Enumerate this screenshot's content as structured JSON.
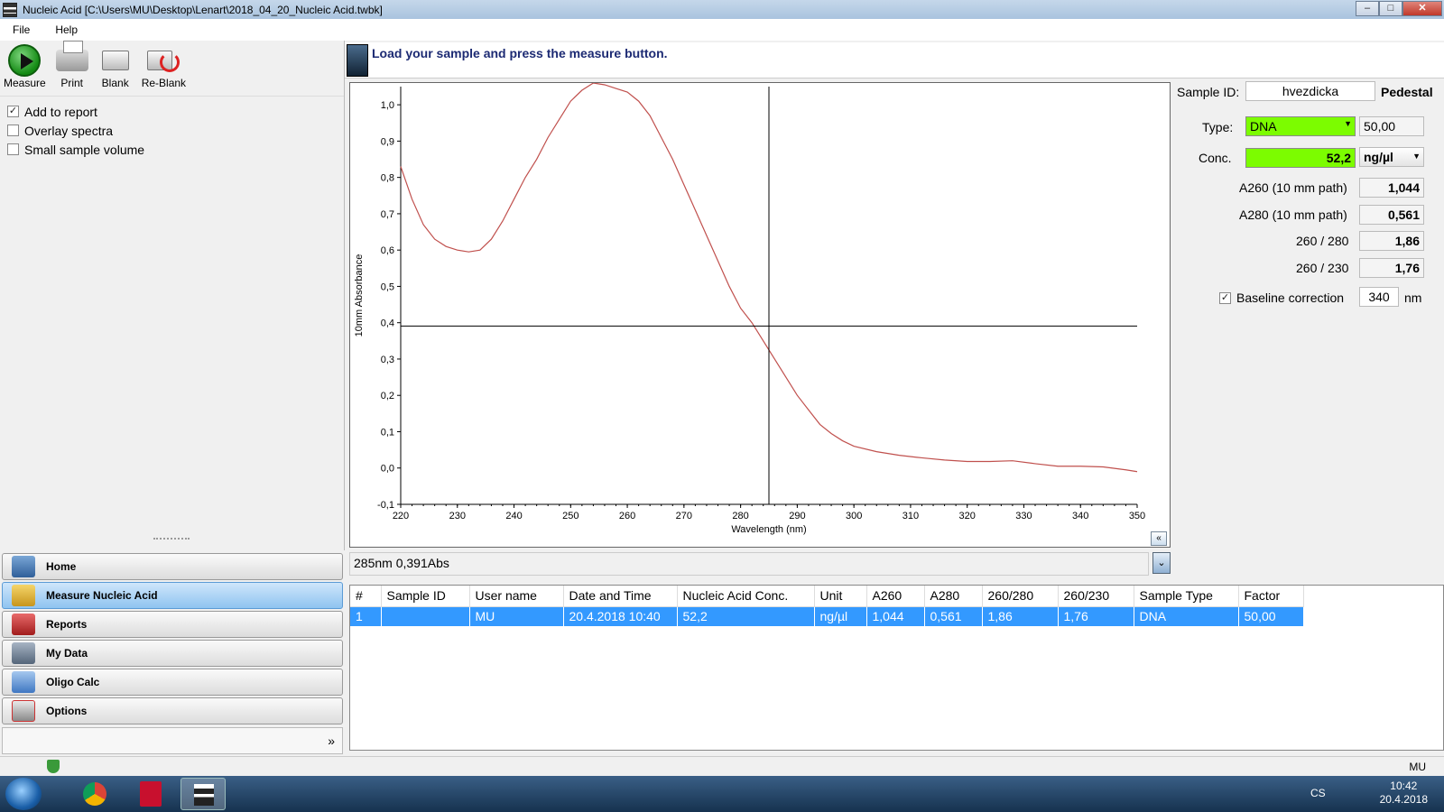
{
  "window": {
    "title": "Nucleic Acid  [C:\\Users\\MU\\Desktop\\Lenart\\2018_04_20_Nucleic Acid.twbk]",
    "minimize": "–",
    "maximize": "□",
    "close": "✕"
  },
  "menu": {
    "file": "File",
    "help": "Help"
  },
  "toolbar": {
    "measure": "Measure",
    "print": "Print",
    "blank": "Blank",
    "reblank": "Re-Blank"
  },
  "options": {
    "add_to_report": {
      "label": "Add to report",
      "checked": true
    },
    "overlay_spectra": {
      "label": "Overlay spectra",
      "checked": false
    },
    "small_sample_volume": {
      "label": "Small sample volume",
      "checked": false
    }
  },
  "nav": {
    "items": [
      {
        "label": "Home",
        "icon": "home-icon"
      },
      {
        "label": "Measure Nucleic Acid",
        "icon": "measure-icon",
        "active": true
      },
      {
        "label": "Reports",
        "icon": "reports-icon"
      },
      {
        "label": "My Data",
        "icon": "my-data-icon"
      },
      {
        "label": "Oligo Calc",
        "icon": "calculator-icon"
      },
      {
        "label": "Options",
        "icon": "options-icon"
      }
    ],
    "expand": "»"
  },
  "instruction": "Load your sample and press the measure button.",
  "chart_data": {
    "type": "line",
    "title": "",
    "xlabel": "Wavelength (nm)",
    "ylabel": "10mm Absorbance",
    "xlim": [
      220,
      350
    ],
    "ylim": [
      -0.1,
      1.05
    ],
    "xticks": [
      "220",
      "230",
      "240",
      "250",
      "260",
      "270",
      "280",
      "290",
      "300",
      "310",
      "320",
      "330",
      "340",
      "350"
    ],
    "yticks": [
      "1,0",
      "0,9",
      "0,8",
      "0,7",
      "0,6",
      "0,5",
      "0,4",
      "0,3",
      "0,2",
      "0,1",
      "0,0",
      "-0,1"
    ],
    "cursor": {
      "x": 285,
      "y": 0.391
    },
    "series": [
      {
        "color": "#c0504d",
        "x": [
          220,
          222,
          224,
          226,
          228,
          230,
          232,
          234,
          236,
          238,
          240,
          242,
          244,
          246,
          248,
          250,
          252,
          254,
          256,
          258,
          260,
          262,
          264,
          266,
          268,
          270,
          272,
          274,
          276,
          278,
          280,
          282,
          284,
          286,
          288,
          290,
          292,
          294,
          296,
          298,
          300,
          304,
          308,
          312,
          316,
          320,
          324,
          328,
          332,
          336,
          340,
          344,
          348,
          350
        ],
        "y": [
          0.83,
          0.74,
          0.67,
          0.63,
          0.61,
          0.6,
          0.595,
          0.6,
          0.63,
          0.68,
          0.74,
          0.8,
          0.85,
          0.91,
          0.96,
          1.01,
          1.04,
          1.06,
          1.055,
          1.045,
          1.035,
          1.01,
          0.97,
          0.91,
          0.85,
          0.78,
          0.71,
          0.64,
          0.57,
          0.5,
          0.44,
          0.4,
          0.35,
          0.3,
          0.25,
          0.2,
          0.16,
          0.12,
          0.095,
          0.075,
          0.06,
          0.045,
          0.035,
          0.028,
          0.022,
          0.018,
          0.018,
          0.02,
          0.012,
          0.005,
          0.005,
          0.003,
          -0.005,
          -0.01
        ]
      }
    ]
  },
  "readout": "285nm 0,391Abs",
  "sample": {
    "id_label": "Sample ID:",
    "id_value": "hvezdicka",
    "mode": "Pedestal",
    "type_label": "Type:",
    "type_value": "DNA",
    "factor": "50,00",
    "conc_label": "Conc.",
    "conc_value": "52,2",
    "unit": "ng/µl",
    "a260_label": "A260 (10 mm path)",
    "a260_value": "1,044",
    "a280_label": "A280 (10 mm path)",
    "a280_value": "0,561",
    "r260_280_label": "260 / 280",
    "r260_280_value": "1,86",
    "r260_230_label": "260 / 230",
    "r260_230_value": "1,76",
    "baseline_label": "Baseline correction",
    "baseline_checked": true,
    "baseline_value": "340",
    "baseline_unit": "nm"
  },
  "table": {
    "columns": [
      "#",
      "Sample ID",
      "User name",
      "Date and Time",
      "Nucleic Acid Conc.",
      "Unit",
      "A260",
      "A280",
      "260/280",
      "260/230",
      "Sample Type",
      "Factor"
    ],
    "rows": [
      [
        "1",
        "",
        "MU",
        "20.4.2018 10:40",
        "52,2",
        "ng/µl",
        "1,044",
        "0,561",
        "1,86",
        "1,76",
        "DNA",
        "50,00"
      ]
    ]
  },
  "status": {
    "user": "MU"
  },
  "taskbar": {
    "lang": "CS",
    "time": "10:42",
    "date": "20.4.2018"
  }
}
